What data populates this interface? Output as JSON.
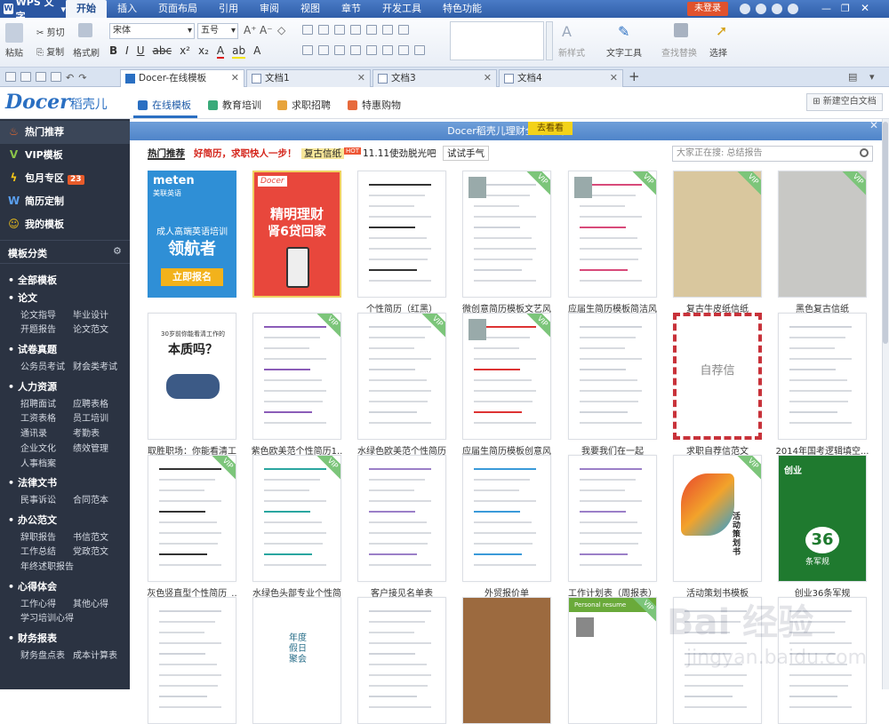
{
  "menubar": {
    "app": "WPS 文字",
    "items": [
      "开始",
      "插入",
      "页面布局",
      "引用",
      "审阅",
      "视图",
      "章节",
      "开发工具",
      "特色功能"
    ],
    "login": "未登录"
  },
  "ribbon": {
    "paste": "粘贴",
    "cut": "剪切",
    "copy": "复制",
    "format_painter": "格式刷",
    "font": "宋体",
    "size": "五号",
    "new_style": "新样式",
    "text_tools": "文字工具",
    "find_replace": "查找替换",
    "select": "选择"
  },
  "tabs": [
    "Docer-在线模板",
    "文档1",
    "文档3",
    "文档4"
  ],
  "docer": {
    "logo": "Docer",
    "logo_cn": "稻壳儿",
    "nav": [
      "在线模板",
      "教育培训",
      "求职招聘",
      "特惠购物"
    ],
    "new_blank": "新建空白文档"
  },
  "sidebar": {
    "top": [
      {
        "label": "热门推荐"
      },
      {
        "label": "VIP模板"
      },
      {
        "label": "包月专区",
        "badge": "23"
      },
      {
        "label": "简历定制"
      },
      {
        "label": "我的模板"
      }
    ],
    "section_title": "模板分类",
    "categories": [
      {
        "name": "全部模板",
        "subs": []
      },
      {
        "name": "论文",
        "subs": [
          "论文指导",
          "毕业设计",
          "开题报告",
          "论文范文"
        ]
      },
      {
        "name": "试卷真题",
        "subs": [
          "公务员考试",
          "财会类考试"
        ]
      },
      {
        "name": "人力资源",
        "subs": [
          "招聘面试",
          "应聘表格",
          "工资表格",
          "员工培训",
          "通讯录",
          "考勤表",
          "企业文化",
          "绩效管理",
          "人事档案"
        ]
      },
      {
        "name": "法律文书",
        "subs": [
          "民事诉讼",
          "合同范本"
        ]
      },
      {
        "name": "办公范文",
        "subs": [
          "辞职报告",
          "书信范文",
          "工作总结",
          "党政范文",
          "年终述职报告"
        ]
      },
      {
        "name": "心得体会",
        "subs": [
          "工作心得",
          "其他心得",
          "学习培训心得"
        ]
      },
      {
        "name": "财务报表",
        "subs": [
          "财务盘点表",
          "成本计算表"
        ]
      }
    ]
  },
  "promo": {
    "text": "Docer稻壳儿理财全新上线",
    "button": "去看看"
  },
  "filters": {
    "selected": "热门推荐",
    "headline": "好简历，求职快人一步！",
    "tag1": "复古信纸",
    "hot": "HOT",
    "tag2": "11.11使劲脱光吧",
    "tag3": "试试手气",
    "search_placeholder": "大家正在搜: 总结报告"
  },
  "cards": [
    {
      "title": "",
      "vip": false,
      "style": "ad-meten",
      "ad": {
        "brand": "meten",
        "brand_cn": "美联英语",
        "line1": "成人高端英语培训",
        "line2": "领航者",
        "cta": "立即报名"
      }
    },
    {
      "title": "",
      "vip": false,
      "style": "ad-docer",
      "ad": {
        "brand": "Docer",
        "line1": "精明理财",
        "line2": "肾6贷回家"
      }
    },
    {
      "title": "个性简历（红黑）",
      "vip": false,
      "style": "resume-rb"
    },
    {
      "title": "微创意简历模板文艺风",
      "vip": true,
      "style": "resume"
    },
    {
      "title": "应届生简历模板简洁风",
      "vip": true,
      "style": "resume-pink"
    },
    {
      "title": "复古牛皮纸信纸",
      "vip": true,
      "style": "kraft"
    },
    {
      "title": "黑色复古信纸",
      "vip": true,
      "style": "grey"
    },
    {
      "title": "取胜职场：你能看清工",
      "vip": false,
      "style": "flyman",
      "ad": {
        "line1": "30岁前你能看清工作的",
        "line2": "本质吗？"
      }
    },
    {
      "title": "紫色欧美范个性简历1..",
      "vip": true,
      "style": "purple"
    },
    {
      "title": "水绿色欧美范个性简历",
      "vip": true,
      "style": "plain"
    },
    {
      "title": "应届生简历模板创意风",
      "vip": true,
      "style": "resume-red"
    },
    {
      "title": "我要我们在一起",
      "vip": false,
      "style": "plain"
    },
    {
      "title": "求职自荐信范文",
      "vip": false,
      "style": "airmail",
      "ad": {
        "line1": "自荐信"
      }
    },
    {
      "title": "2014年国考逻辑填空...",
      "vip": false,
      "style": "plain"
    },
    {
      "title": "灰色竖直型个性简历_..",
      "vip": true,
      "style": "js"
    },
    {
      "title": "水绿色头部专业个性简",
      "vip": true,
      "style": "teal"
    },
    {
      "title": "客户接见名单表",
      "vip": false,
      "style": "table"
    },
    {
      "title": "外贸报价单",
      "vip": false,
      "style": "price"
    },
    {
      "title": "工作计划表（周报表）",
      "vip": false,
      "style": "table"
    },
    {
      "title": "活动策划书模板",
      "vip": true,
      "style": "swirl",
      "ad": {
        "line1": "活动策划书"
      }
    },
    {
      "title": "创业36条军规",
      "vip": false,
      "style": "green36",
      "ad": {
        "line1": "创业",
        "num": "36",
        "line2": "条军规"
      }
    },
    {
      "title": "",
      "vip": false,
      "style": "plain"
    },
    {
      "title": "",
      "vip": false,
      "style": "party",
      "ad": {
        "line1": "年度",
        "line2": "假日",
        "line3": "聚会"
      }
    },
    {
      "title": "",
      "vip": false,
      "style": "plain"
    },
    {
      "title": "",
      "vip": false,
      "style": "brown"
    },
    {
      "title": "",
      "vip": true,
      "style": "greenresume",
      "ad": {
        "line1": "Personal resume"
      }
    },
    {
      "title": "",
      "vip": false,
      "style": "plain"
    },
    {
      "title": "",
      "vip": false,
      "style": "plain"
    }
  ],
  "watermark": {
    "line1": "Bai 经验",
    "line2": "jingyan.baidu.com"
  },
  "colors": {
    "sidebar": "#2b3342",
    "accent": "#2a6fc2",
    "promo": "#5b8fd0",
    "vip": "#7cc57a"
  }
}
